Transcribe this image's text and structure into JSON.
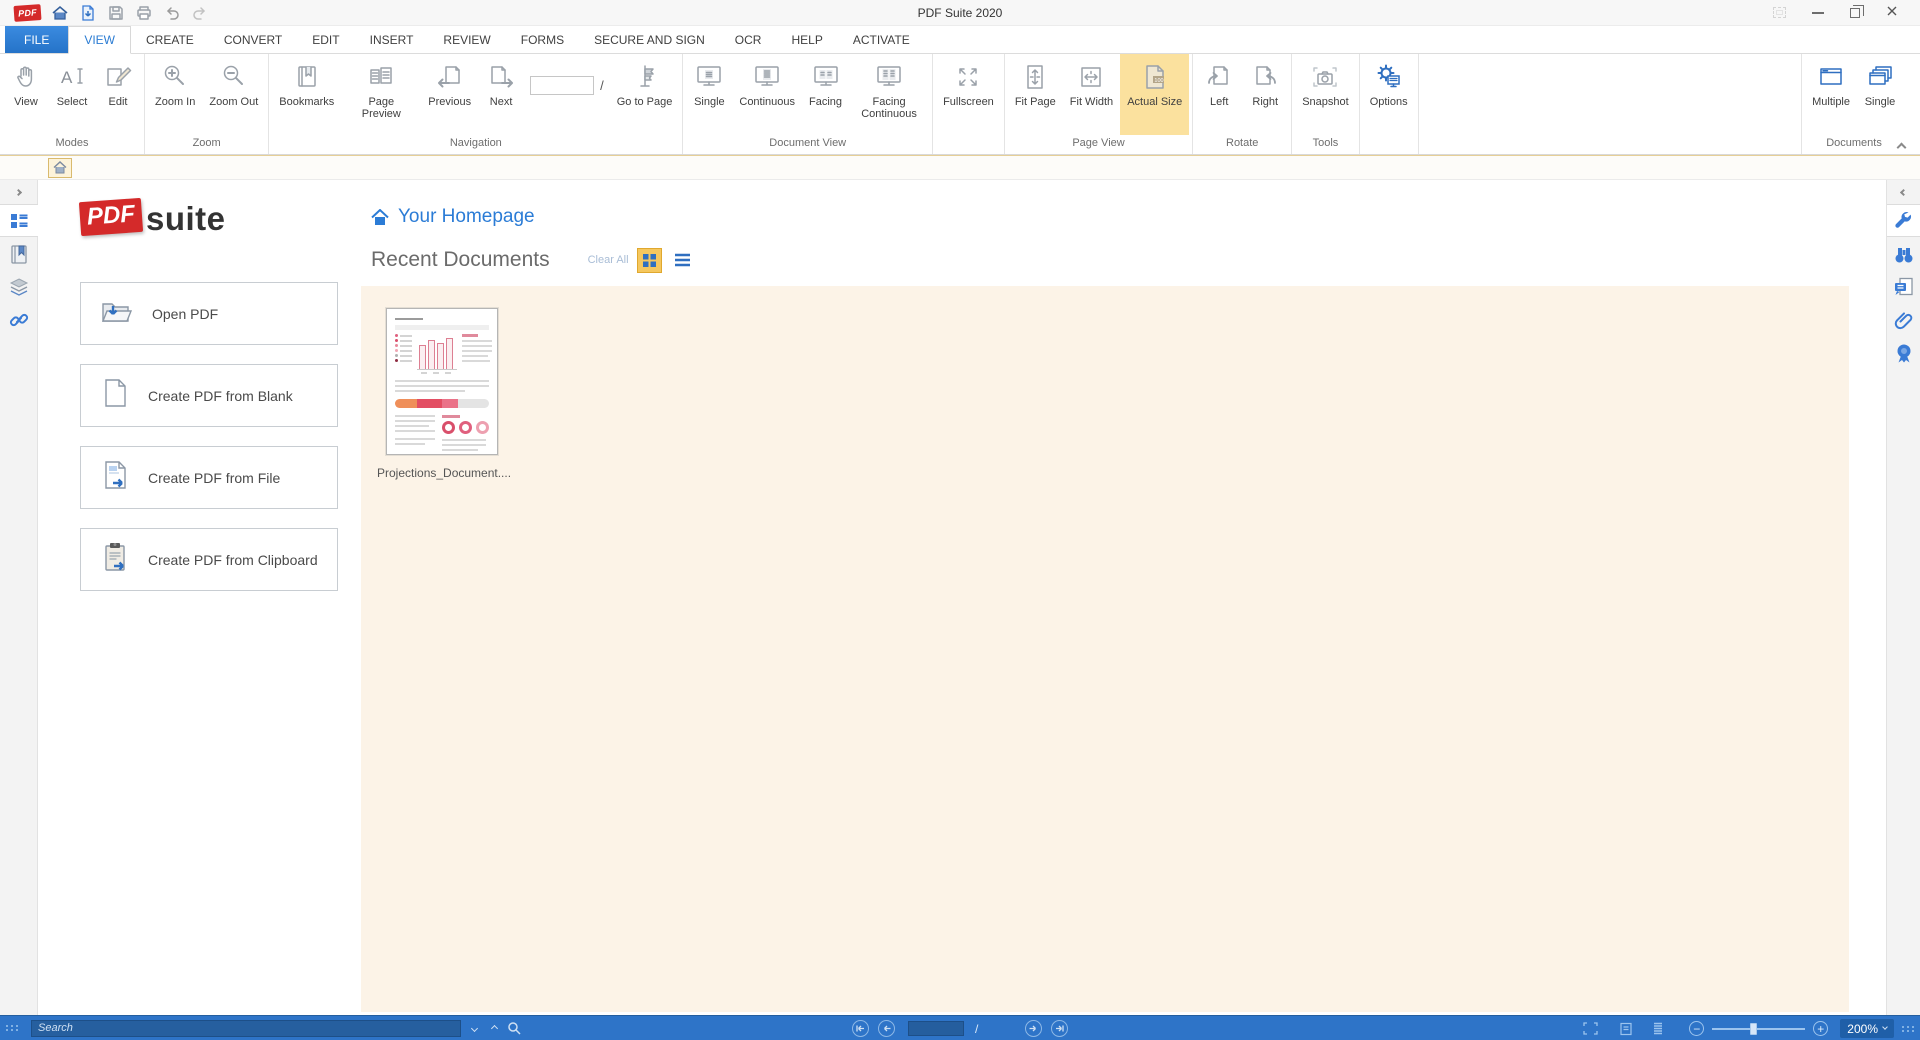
{
  "window": {
    "title": "PDF Suite 2020"
  },
  "menu": {
    "file": "FILE",
    "view": "VIEW",
    "items": [
      "CREATE",
      "CONVERT",
      "EDIT",
      "INSERT",
      "REVIEW",
      "FORMS",
      "SECURE AND SIGN",
      "OCR",
      "HELP",
      "ACTIVATE"
    ]
  },
  "ribbon": {
    "modes": {
      "label": "Modes",
      "view": "View",
      "select": "Select",
      "edit": "Edit"
    },
    "zoom": {
      "label": "Zoom",
      "zoom_in": "Zoom In",
      "zoom_out": "Zoom Out"
    },
    "navigation": {
      "label": "Navigation",
      "bookmarks": "Bookmarks",
      "page_preview": "Page Preview",
      "previous": "Previous",
      "next": "Next",
      "slash": "/",
      "go_to_page": "Go to Page"
    },
    "document_view": {
      "label": "Document View",
      "single": "Single",
      "continuous": "Continuous",
      "facing": "Facing",
      "facing_continuous": "Facing Continuous"
    },
    "fullscreen_group": {
      "fullscreen": "Fullscreen"
    },
    "page_view": {
      "label": "Page View",
      "fit_page": "Fit Page",
      "fit_width": "Fit Width",
      "actual_size": "Actual Size"
    },
    "rotate": {
      "label": "Rotate",
      "left": "Left",
      "right": "Right"
    },
    "tools": {
      "label": "Tools",
      "snapshot": "Snapshot"
    },
    "options_group": {
      "options": "Options"
    },
    "documents": {
      "label": "Documents",
      "multiple": "Multiple",
      "single": "Single"
    }
  },
  "homepage": {
    "logo_pdf": "PDF",
    "logo_suite": "suite",
    "title": "Your Homepage",
    "section_title": "Recent Documents",
    "clear_all": "Clear All",
    "actions": [
      {
        "label": "Open PDF"
      },
      {
        "label": "Create PDF from Blank"
      },
      {
        "label": "Create PDF from File"
      },
      {
        "label": "Create PDF from Clipboard"
      }
    ],
    "recent": [
      {
        "name": "Projections_Document...."
      }
    ]
  },
  "statusbar": {
    "search_placeholder": "Search",
    "page_slash": "/",
    "zoom_level": "200%"
  },
  "colors": {
    "accent_blue": "#2b7cd3",
    "statusbar_blue": "#2e74c8",
    "highlight_gold": "#fbe19e",
    "panel_cream": "#fcf3e7",
    "logo_red": "#d42a2a"
  }
}
